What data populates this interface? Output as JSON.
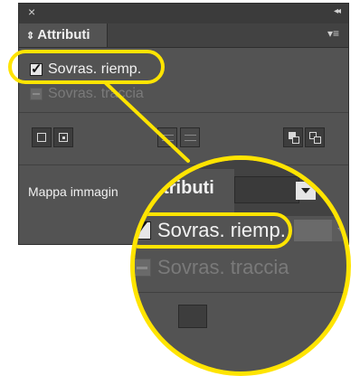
{
  "panel": {
    "close_glyph": "×",
    "collapse_glyph": "◂◂",
    "tab_label": "Attributi",
    "tab_arrow": "⇕",
    "menu_glyph": "▾≡"
  },
  "checks": {
    "fill_overprint_label": "Sovras. riemp.",
    "fill_overprint_checked": true,
    "stroke_overprint_label": "Sovras. traccia",
    "stroke_overprint_enabled": false
  },
  "image_map": {
    "label": "Mappa immagin"
  },
  "magnifier": {
    "tab_label": "Attributi",
    "fill_overprint_label": "Sovras. riemp.",
    "stroke_overprint_label": "Sovras. traccia"
  },
  "colors": {
    "highlight": "#ffe400",
    "panel_bg": "#535353"
  }
}
